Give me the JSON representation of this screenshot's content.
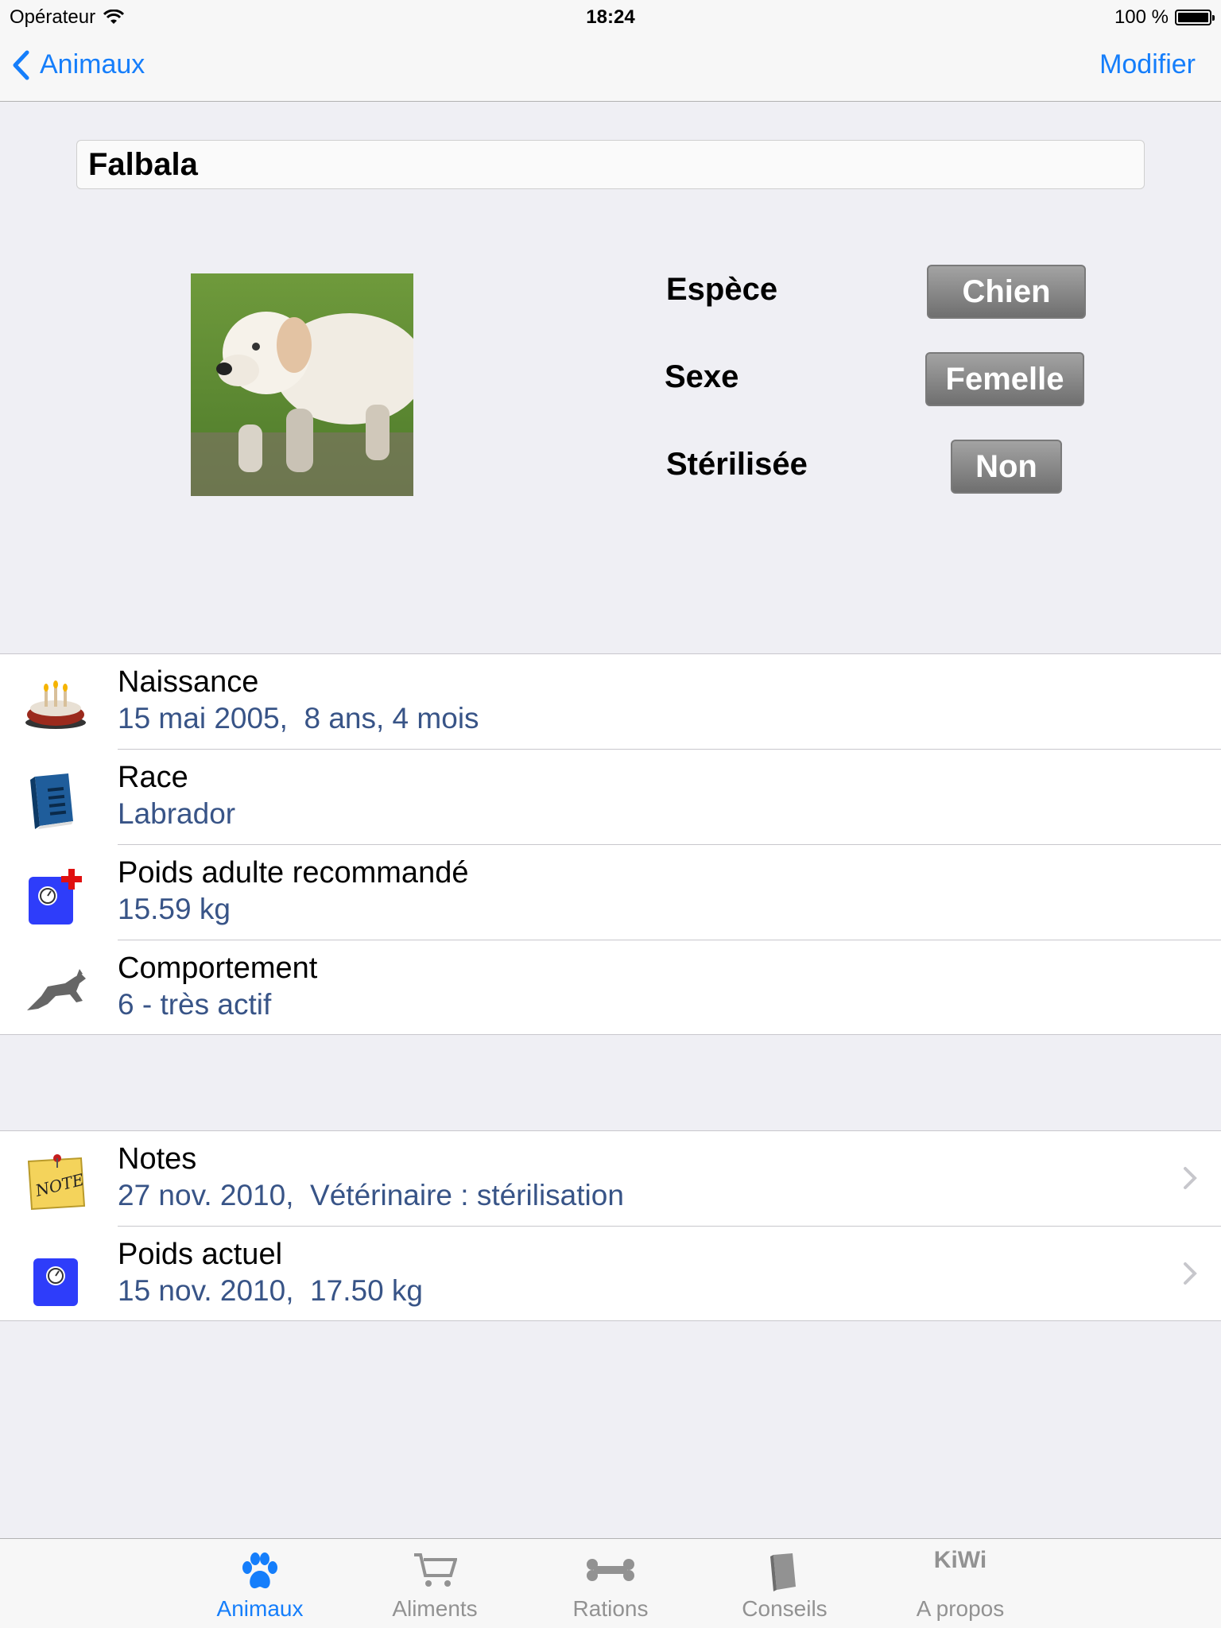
{
  "status_bar": {
    "carrier": "Opérateur",
    "time": "18:24",
    "battery": "100 %"
  },
  "nav": {
    "back_label": "Animaux",
    "edit_label": "Modifier"
  },
  "animal": {
    "name": "Falbala",
    "photo_icon": "dog-photo",
    "attributes": [
      {
        "label": "Espèce",
        "value": "Chien"
      },
      {
        "label": "Sexe",
        "value": "Femelle"
      },
      {
        "label": "Stérilisée",
        "value": "Non"
      }
    ]
  },
  "info_rows": [
    {
      "icon": "birthday-cake-icon",
      "title": "Naissance",
      "detail": "15 mai 2005,  8 ans, 4 mois"
    },
    {
      "icon": "book-icon",
      "title": "Race",
      "detail": "Labrador"
    },
    {
      "icon": "scale-plus-icon",
      "title": "Poids adulte recommandé",
      "detail": "15.59 kg"
    },
    {
      "icon": "running-dog-icon",
      "title": "Comportement",
      "detail": "6 - très actif"
    }
  ],
  "history_rows": [
    {
      "icon": "note-icon",
      "title": "Notes",
      "detail": "27 nov. 2010,  Vétérinaire : stérilisation",
      "note_text": "NOTE"
    },
    {
      "icon": "scale-icon",
      "title": "Poids actuel",
      "detail": "15 nov. 2010,  17.50 kg"
    }
  ],
  "tab_bar": {
    "tabs": [
      {
        "label": "Animaux",
        "icon": "paw-icon",
        "active": true
      },
      {
        "label": "Aliments",
        "icon": "cart-icon",
        "active": false
      },
      {
        "label": "Rations",
        "icon": "bone-icon",
        "active": false
      },
      {
        "label": "Conseils",
        "icon": "book-icon",
        "active": false
      },
      {
        "label": "A propos",
        "icon": "kiwi-icon",
        "icon_text": "KiWi",
        "active": false
      }
    ]
  },
  "colors": {
    "accent": "#157efb",
    "detail_text": "#385487",
    "background": "#efeff4",
    "inactive_tab": "#929292"
  }
}
